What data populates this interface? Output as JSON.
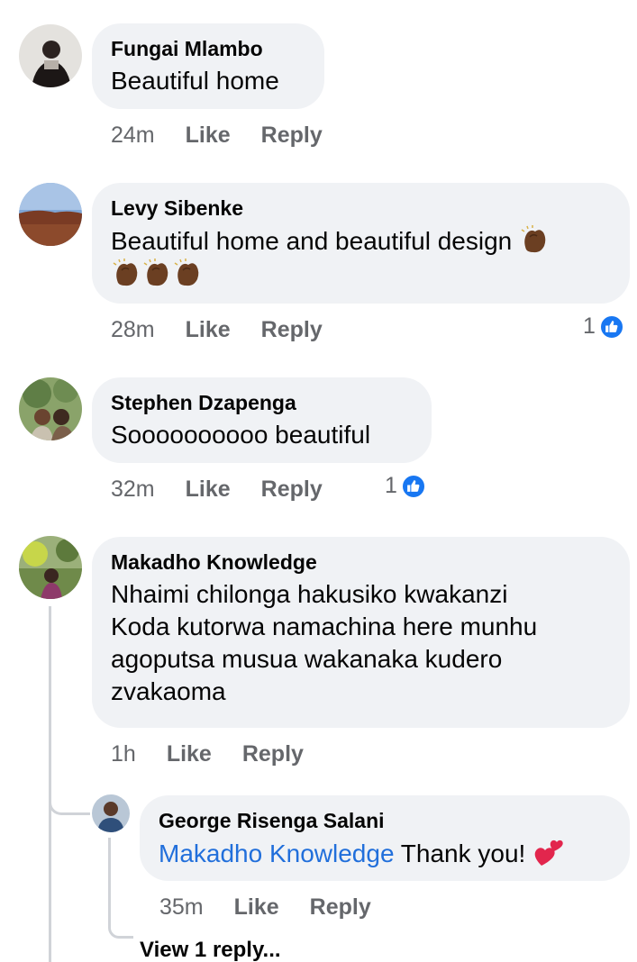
{
  "comments": [
    {
      "author": "Fungai Mlambo",
      "text": "Beautiful home",
      "time": "24m",
      "like_label": "Like",
      "reply_label": "Reply"
    },
    {
      "author": "Levy Sibenke",
      "text": "Beautiful home and beautiful design",
      "emoji_icons": [
        "clapping-hands-icon",
        "clapping-hands-icon",
        "clapping-hands-icon",
        "clapping-hands-icon"
      ],
      "time": "28m",
      "like_label": "Like",
      "reply_label": "Reply",
      "reaction_count": "1",
      "reaction_icon": "thumbs-up-icon"
    },
    {
      "author": "Stephen Dzapenga",
      "text": "Soooooooooo beautiful",
      "time": "32m",
      "like_label": "Like",
      "reply_label": "Reply",
      "reaction_count": "1",
      "reaction_icon": "thumbs-up-icon"
    },
    {
      "author": "Makadho Knowledge",
      "text_lines": [
        "Nhaimi chilonga hakusiko kwakanzi",
        "Koda kutorwa namachina here munhu",
        "agoputsa musua wakanaka kudero",
        "zvakaoma"
      ],
      "time": "1h",
      "like_label": "Like",
      "reply_label": "Reply"
    }
  ],
  "reply": {
    "author": "George Risenga Salani",
    "mention": "Makadho Knowledge",
    "text": "Thank you!",
    "emoji_icon": "two-hearts-icon",
    "time": "35m",
    "like_label": "Like",
    "reply_label": "Reply"
  },
  "view_replies_label": "View 1 reply...",
  "colors": {
    "bubble": "#f0f2f5",
    "meta_text": "#65676b",
    "mention": "#216fdb",
    "like_badge": "#1877f2"
  }
}
